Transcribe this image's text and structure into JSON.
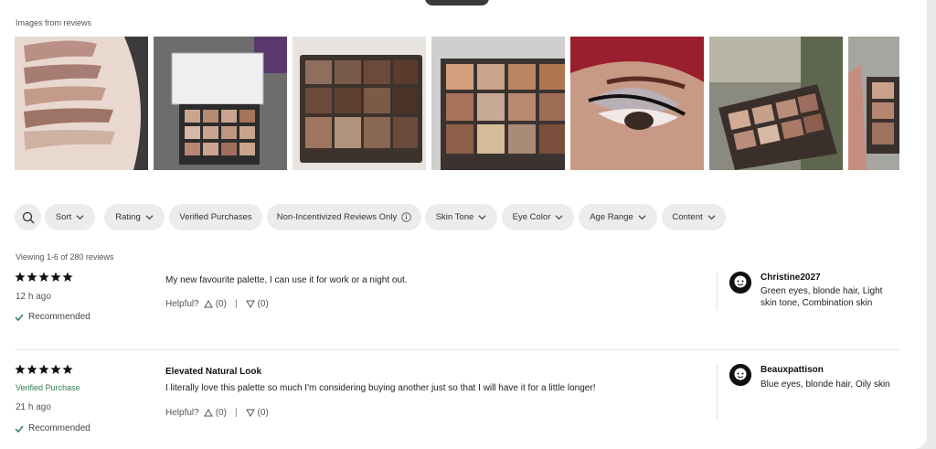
{
  "gallery": {
    "title": "Images from reviews",
    "images": [
      {
        "name": "arm swatches"
      },
      {
        "name": "palette on table"
      },
      {
        "name": "palette on fur"
      },
      {
        "name": "palette closeup"
      },
      {
        "name": "eye makeup look"
      },
      {
        "name": "palette in hand"
      },
      {
        "name": "palette partial"
      }
    ]
  },
  "filters": {
    "search_icon": "search-icon",
    "chips": [
      {
        "label": "Sort",
        "has_chevron": true
      },
      {
        "label": "Rating",
        "has_chevron": true
      },
      {
        "label": "Verified Purchases",
        "has_chevron": false
      },
      {
        "label": "Non-Incentivized Reviews Only",
        "has_info": true
      },
      {
        "label": "Skin Tone",
        "has_chevron": true
      },
      {
        "label": "Eye Color",
        "has_chevron": true
      },
      {
        "label": "Age Range",
        "has_chevron": true
      },
      {
        "label": "Content",
        "has_chevron": true
      }
    ]
  },
  "summary": {
    "viewing": "Viewing 1-6 of 280 reviews"
  },
  "reviews": [
    {
      "rating": 5,
      "verified": "",
      "time": "12 h ago",
      "recommended": "Recommended",
      "title": "",
      "body": "My new favourite palette, I can use it for work or a night out.",
      "helpful_label": "Helpful?",
      "up_count": "(0)",
      "down_count": "(0)",
      "separator": "|",
      "user": {
        "name": "Christine2027",
        "info": "Green eyes, blonde hair, Light skin tone, Combination skin"
      }
    },
    {
      "rating": 5,
      "verified": "Verified Purchase",
      "time": "21 h ago",
      "recommended": "Recommended",
      "title": "Elevated Natural Look",
      "body": "I literally love this palette so much I'm considering buying another just so that I will have it for a little longer!",
      "helpful_label": "Helpful?",
      "up_count": "(0)",
      "down_count": "(0)",
      "separator": "|",
      "user": {
        "name": "Beauxpattison",
        "info": "Blue eyes, blonde hair, Oily skin"
      }
    }
  ],
  "colors": {
    "verified": "#2f7d4f",
    "chip_bg": "#ececec",
    "star": "#111111"
  }
}
